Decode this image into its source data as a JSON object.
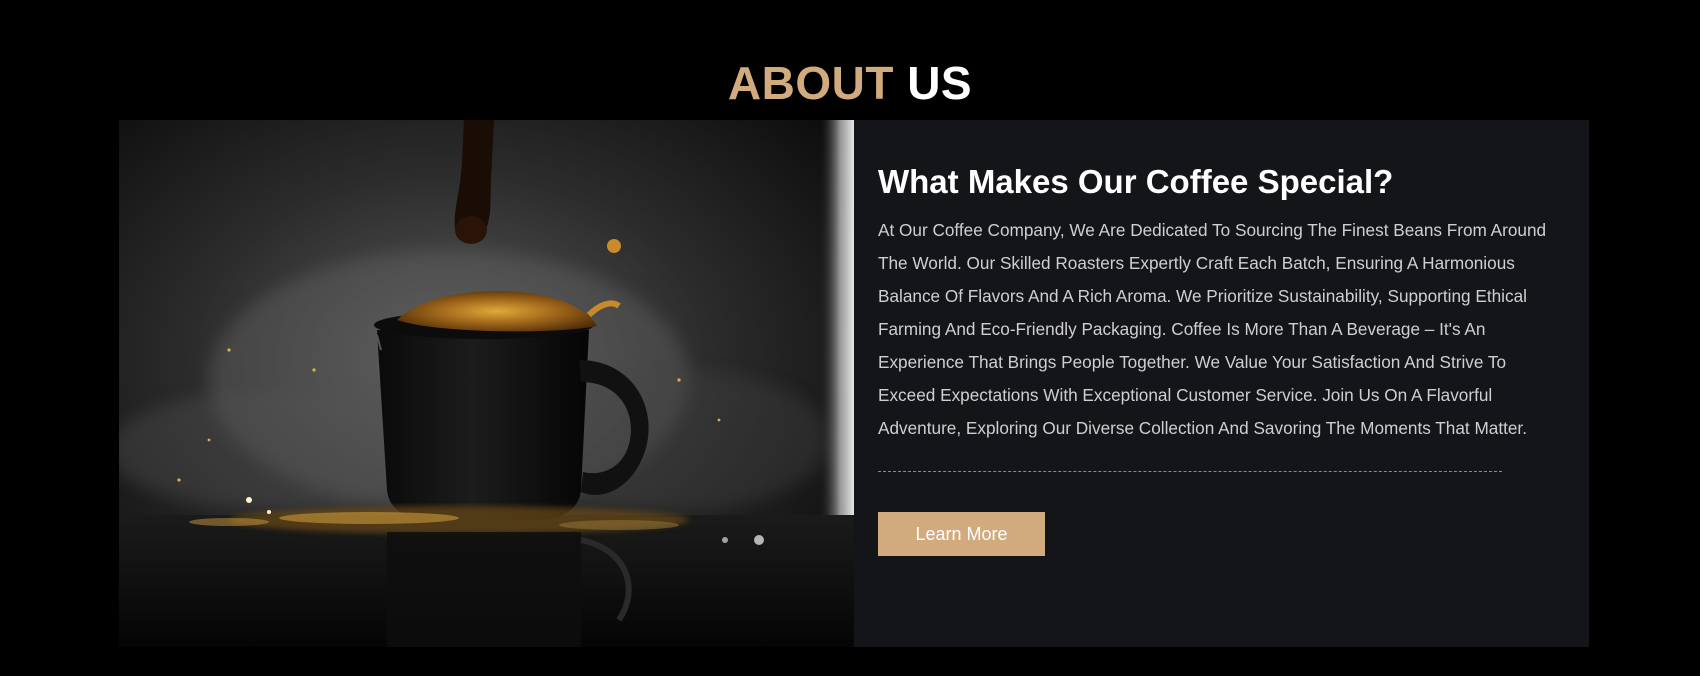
{
  "section": {
    "title_accent": "ABOUT",
    "title_rest": "US"
  },
  "about": {
    "heading": "What Makes Our Coffee Special?",
    "body": "At Our Coffee Company, We Are Dedicated To Sourcing The Finest Beans From Around The World. Our Skilled Roasters Expertly Craft Each Batch, Ensuring A Harmonious Balance Of Flavors And A Rich Aroma. We Prioritize Sustainability, Supporting Ethical Farming And Eco-Friendly Packaging. Coffee Is More Than A Beverage – It's An Experience That Brings People Together. We Value Your Satisfaction And Strive To Exceed Expectations With Exceptional Customer Service. Join Us On A Flavorful Adventure, Exploring Our Diverse Collection And Savoring The Moments That Matter.",
    "button_label": "Learn More"
  },
  "colors": {
    "accent": "#d1ab7e",
    "background": "#000000",
    "card_background": "#141519",
    "text_primary": "#ffffff",
    "text_body": "#cfcfcf"
  },
  "image": {
    "subject": "coffee-cup-splash-photo"
  }
}
